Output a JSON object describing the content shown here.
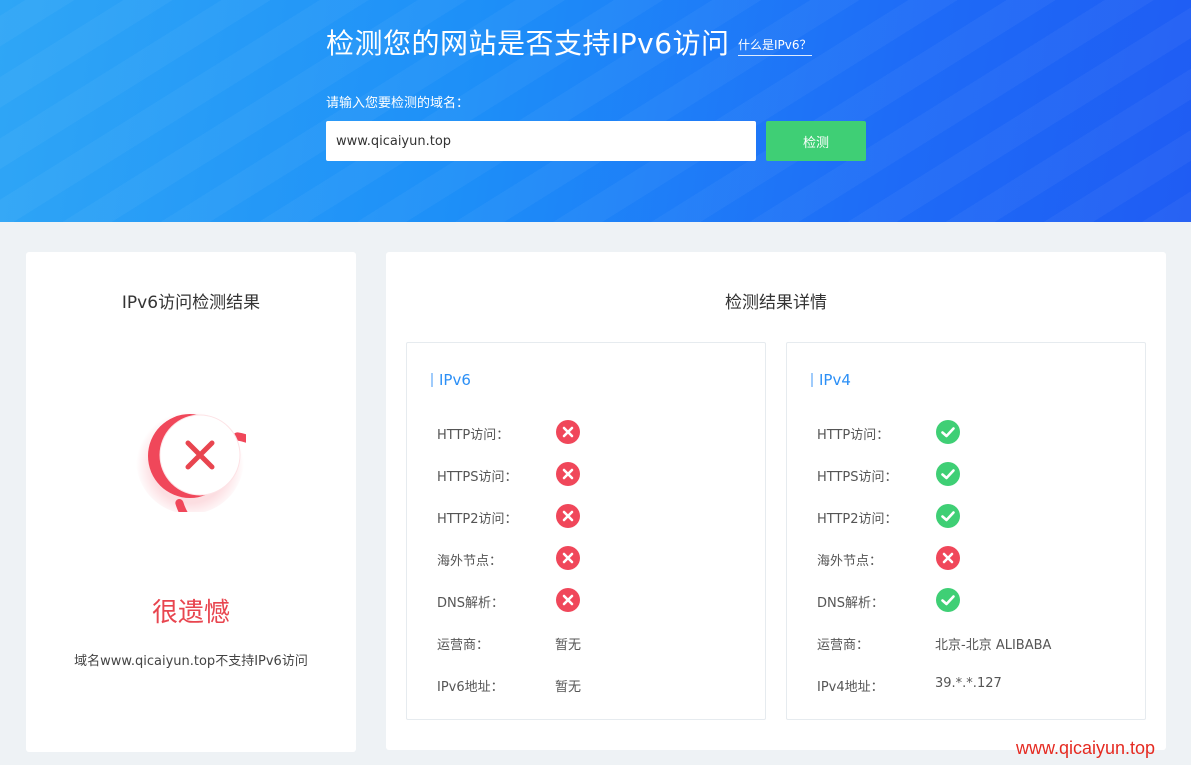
{
  "header": {
    "title": "检测您的网站是否支持IPv6访问",
    "help_link": "什么是IPv6？",
    "input_label": "请输入您要检测的域名：",
    "domain_value": "www.qicaiyun.top",
    "check_button": "检测"
  },
  "left_card": {
    "title": "IPv6访问检测结果",
    "result_title": "很遗憾",
    "result_desc": "域名www.qicaiyun.top不支持IPv6访问",
    "result_icon": "fail-ring-icon",
    "accent_color": "#f0475a"
  },
  "right_card": {
    "title": "检测结果详情",
    "ipv6": {
      "title": "IPv6",
      "rows": [
        {
          "label": "HTTP访问：",
          "status": "fail"
        },
        {
          "label": "HTTPS访问：",
          "status": "fail"
        },
        {
          "label": "HTTP2访问：",
          "status": "fail"
        },
        {
          "label": "海外节点：",
          "status": "fail"
        },
        {
          "label": "DNS解析：",
          "status": "fail"
        },
        {
          "label": "运营商：",
          "value": "暂无"
        },
        {
          "label": "IPv6地址：",
          "value": "暂无"
        }
      ]
    },
    "ipv4": {
      "title": "IPv4",
      "rows": [
        {
          "label": "HTTP访问：",
          "status": "pass"
        },
        {
          "label": "HTTPS访问：",
          "status": "pass"
        },
        {
          "label": "HTTP2访问：",
          "status": "pass"
        },
        {
          "label": "海外节点：",
          "status": "fail"
        },
        {
          "label": "DNS解析：",
          "status": "pass"
        },
        {
          "label": "运营商：",
          "value": "北京-北京 ALIBABA"
        },
        {
          "label": "IPv4地址：",
          "value": "39.*.*.127"
        }
      ]
    }
  },
  "colors": {
    "pass": "#3fcf75",
    "fail": "#f0475a",
    "link": "#2b8ff6"
  },
  "watermark": "www.qicaiyun.top"
}
